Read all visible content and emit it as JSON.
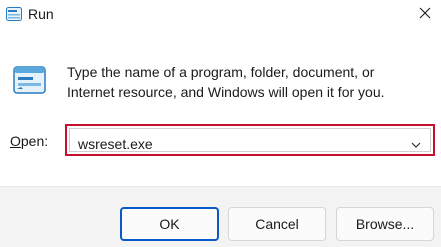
{
  "window": {
    "title": "Run"
  },
  "description": {
    "line1": "Type the name of a program, folder, document, or",
    "line2": "Internet resource, and Windows will open it for you."
  },
  "open_field": {
    "label_accel": "O",
    "label_rest": "pen:",
    "value": "wsreset.exe"
  },
  "buttons": {
    "ok": "OK",
    "cancel": "Cancel",
    "browse": "Browse..."
  },
  "colors": {
    "highlight_border": "#c8102e",
    "ok_border": "#0a59c7",
    "footer_bg": "#f3f3f3"
  },
  "icons": [
    "run-app-icon",
    "close-icon",
    "run-dialog-icon",
    "chevron-down-icon"
  ]
}
